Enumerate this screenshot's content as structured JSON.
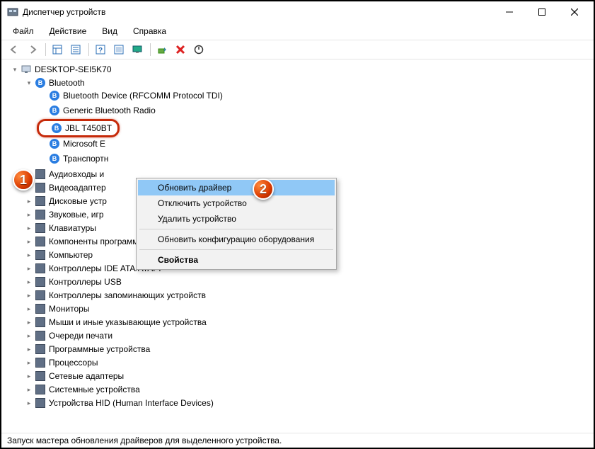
{
  "window": {
    "title": "Диспетчер устройств"
  },
  "menubar": {
    "items": [
      "Файл",
      "Действие",
      "Вид",
      "Справка"
    ]
  },
  "tree": {
    "root": "DESKTOP-SEI5K70",
    "bluetooth": {
      "label": "Bluetooth",
      "children": [
        "Bluetooth Device (RFCOMM Protocol TDI)",
        "Generic Bluetooth Radio",
        "JBL T450BT",
        "Microsoft E",
        "Транспортн"
      ]
    },
    "categories": [
      "Аудиовходы и",
      "Видеоадаптер",
      "Дисковые устр",
      "Звуковые, игр",
      "Клавиатуры",
      "Компоненты программного обеспечения",
      "Компьютер",
      "Контроллеры IDE ATA/ATAPI",
      "Контроллеры USB",
      "Контроллеры запоминающих устройств",
      "Мониторы",
      "Мыши и иные указывающие устройства",
      "Очереди печати",
      "Программные устройства",
      "Процессоры",
      "Сетевые адаптеры",
      "Системные устройства",
      "Устройства HID (Human Interface Devices)"
    ]
  },
  "context_menu": {
    "items": [
      "Обновить драйвер",
      "Отключить устройство",
      "Удалить устройство"
    ],
    "refresh": "Обновить конфигурацию оборудования",
    "properties": "Свойства"
  },
  "statusbar": {
    "text": "Запуск мастера обновления драйверов для выделенного устройства."
  },
  "badges": {
    "one": "1",
    "two": "2"
  }
}
